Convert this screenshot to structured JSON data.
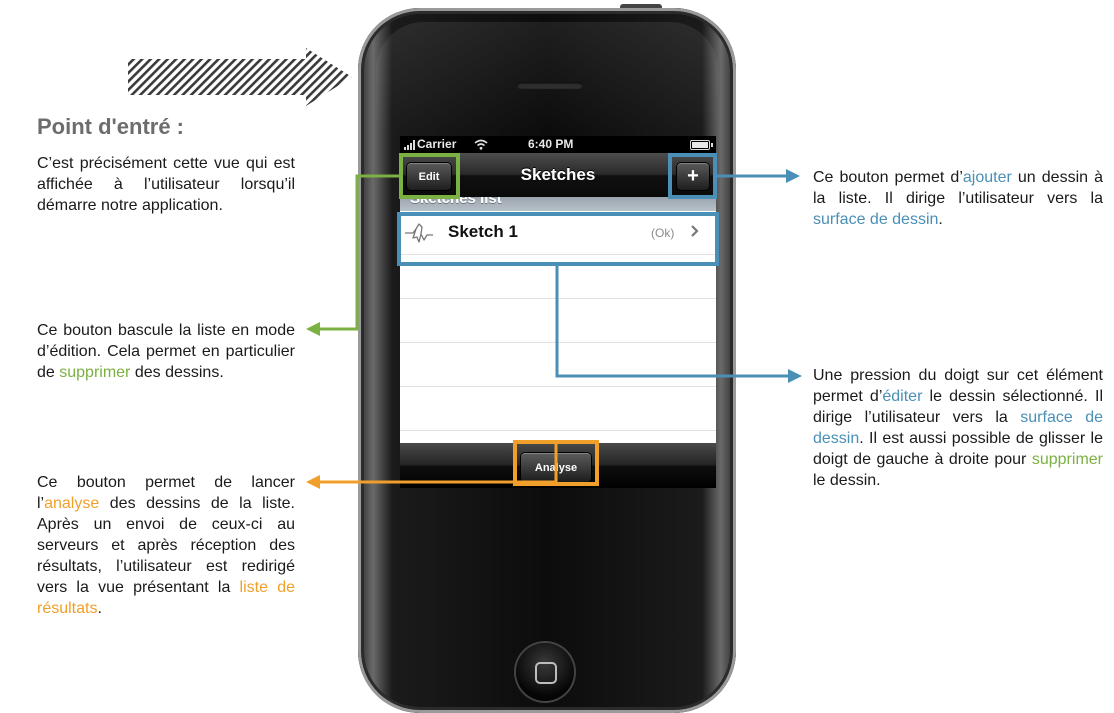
{
  "heading": "Point d'entré :",
  "annotations": {
    "intro": "C’est précisément cette vue qui est affichée à l’utilisateur lorsqu’il démarre notre application.",
    "edit": {
      "before": "Ce bouton bascule la liste en mode d’édition. Cela permet en particulier de ",
      "link": "supprimer",
      "after": " des dessins."
    },
    "analyse": {
      "part1": "Ce bouton permet de lancer l’",
      "link1": "analyse",
      "part2": " des dessins de la liste. Après un envoi de ceux-ci au serveurs et après réception des résultats, l’utilisateur est redirigé vers la vue présentant la ",
      "link2": "liste de résultats",
      "part3": "."
    },
    "add": {
      "part1": "Ce bouton permet d’",
      "link1": "ajouter",
      "part2": " un dessin à la liste. Il dirige l’utilisateur vers la ",
      "link2": "surface de dessin",
      "part3": "."
    },
    "row": {
      "part1": "Une pression du doigt sur cet élément permet d’",
      "link1": "éditer",
      "part2": " le dessin sélectionné. Il dirige l’utilisateur vers la ",
      "link2": "surface de dessin",
      "part3": ". Il est aussi possible de glisser le doigt de gauche à droite pour ",
      "link3": "supprimer",
      "part4": " le dessin."
    }
  },
  "phone": {
    "status_bar": {
      "carrier": "Carrier",
      "time": "6:40 PM"
    },
    "nav": {
      "title": "Sketches",
      "edit_label": "Edit",
      "add_label": "+"
    },
    "section_header": "Sketches list",
    "rows": [
      {
        "name": "Sketch 1",
        "status": "(Ok)"
      }
    ],
    "toolbar": {
      "analyse_label": "Analyse"
    }
  },
  "colors": {
    "green": "#7bb042",
    "blue": "#4a8fb5",
    "orange": "#f0a02a",
    "heading": "#6d6d6d"
  },
  "icons": [
    "striped-arrow-icon",
    "signal-icon",
    "wifi-icon",
    "battery-icon",
    "sketch-shape-icon",
    "chevron-right-icon",
    "home-button-icon"
  ]
}
